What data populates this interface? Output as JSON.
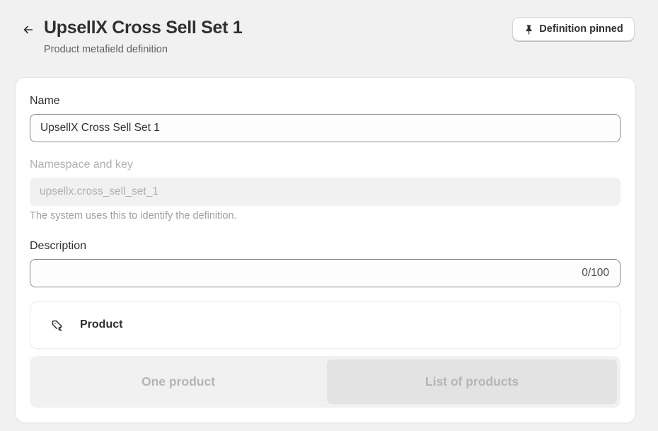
{
  "header": {
    "title": "UpsellX Cross Sell Set 1",
    "subtitle": "Product metafield definition",
    "pin_button_label": "Definition pinned",
    "back_icon": "arrow-left-icon",
    "pin_icon": "pin-icon"
  },
  "form": {
    "name": {
      "label": "Name",
      "value": "UpsellX Cross Sell Set 1"
    },
    "namespace": {
      "label": "Namespace and key",
      "value": "upsellx.cross_sell_set_1",
      "help": "The system uses this to identify the definition."
    },
    "description": {
      "label": "Description",
      "value": "",
      "char_count": "0/100"
    },
    "type": {
      "label": "Product",
      "icon": "product-tag-icon"
    },
    "cardinality": {
      "options": [
        "One product",
        "List of products"
      ],
      "selected": "List of products"
    }
  },
  "colors": {
    "background": "#f1f1f1",
    "card": "#ffffff",
    "text": "#303030",
    "muted": "#b0b0b0",
    "border": "#8a8a8a"
  }
}
